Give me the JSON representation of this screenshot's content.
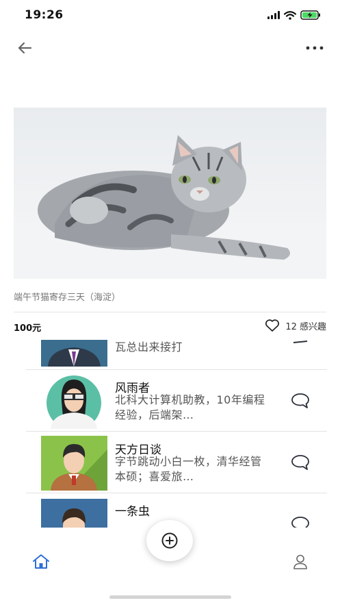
{
  "status_bar": {
    "time": "19:26"
  },
  "listing": {
    "title": "端午节猫寄存三天（海淀）",
    "price": "100元",
    "interest_label": "12 感兴趣"
  },
  "responders": [
    {
      "name": "",
      "description": "瓦总出来接打"
    },
    {
      "name": "风雨者",
      "description": "北科大计算机助教，10年编程经验，后端架…"
    },
    {
      "name": "天方日谈",
      "description": "字节跳动小白一枚，清华经管本硕；喜爱旅…"
    },
    {
      "name": "一条虫",
      "description": ""
    }
  ],
  "icons": {
    "back": "arrow-left-icon",
    "more": "more-horizontal-icon",
    "heart": "heart-icon",
    "chat": "chat-bubble-icon",
    "add": "plus-circle-icon",
    "home": "home-icon",
    "profile": "person-icon"
  },
  "colors": {
    "accent": "#2f6fd6",
    "text": "#111111",
    "muted": "#777777"
  }
}
